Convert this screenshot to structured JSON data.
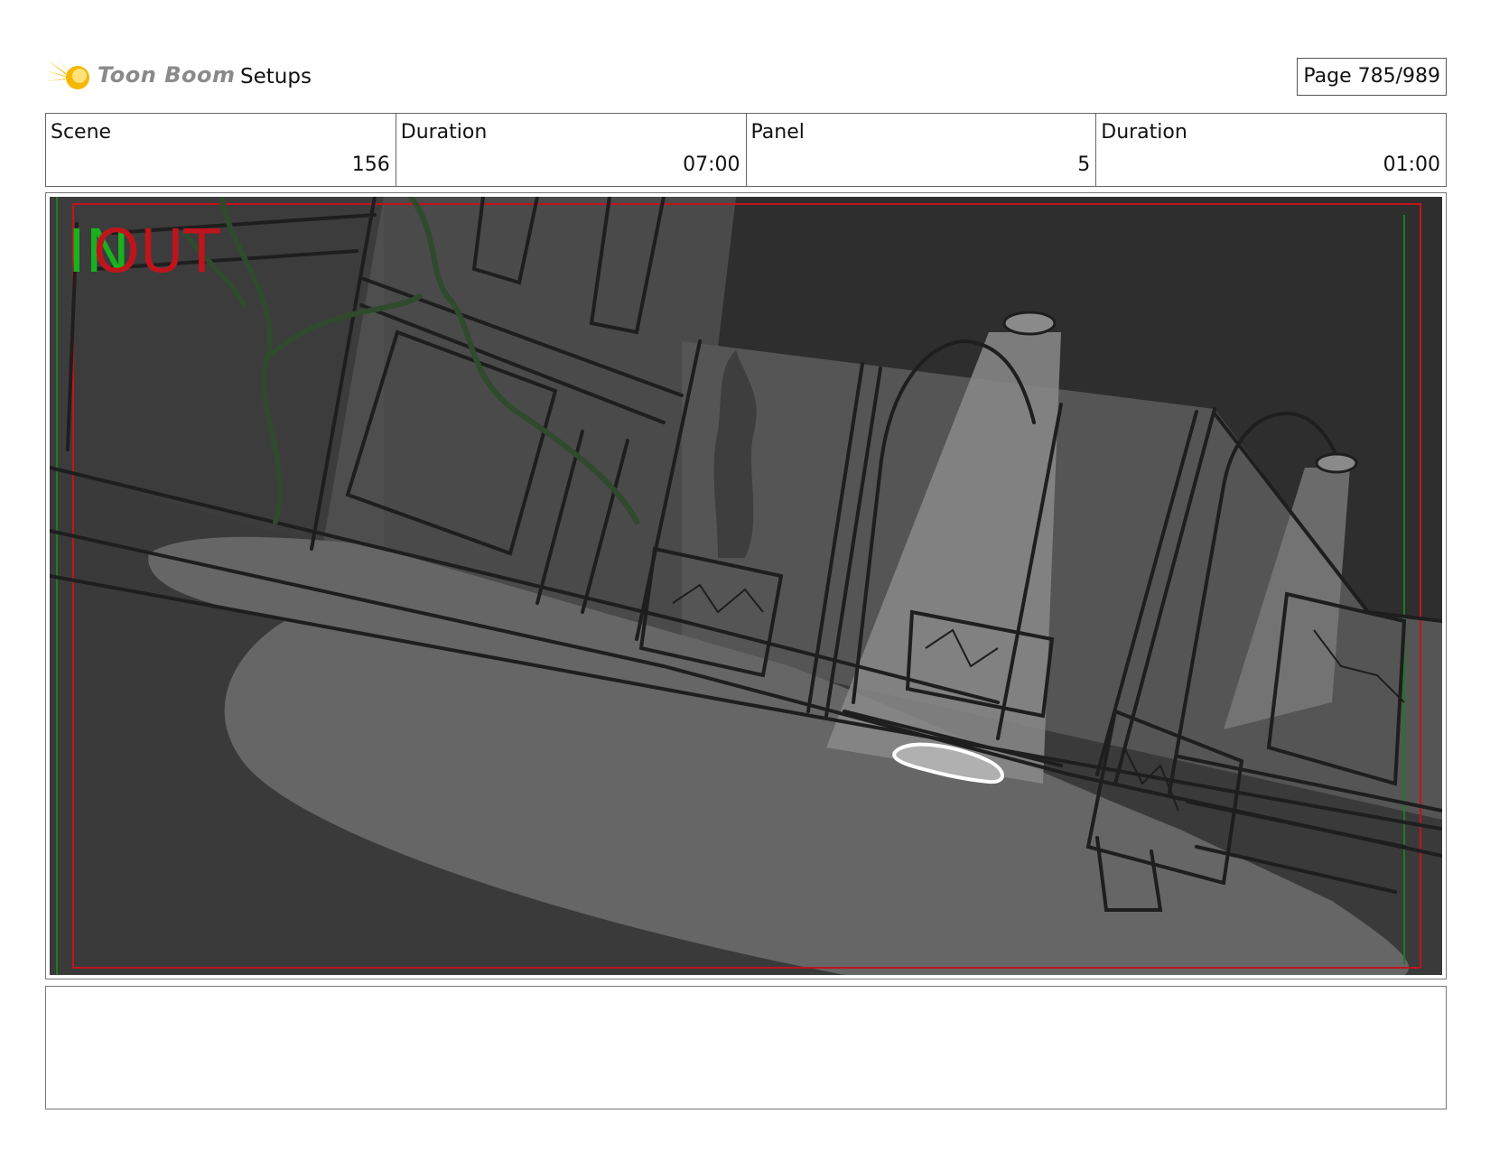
{
  "header": {
    "logo_text": "Toon Boom",
    "section_title": "Setups",
    "page_label": "Page 785/989"
  },
  "info": {
    "scene_label": "Scene",
    "scene_value": "156",
    "scene_duration_label": "Duration",
    "scene_duration_value": "07:00",
    "panel_label": "Panel",
    "panel_value": "5",
    "panel_duration_label": "Duration",
    "panel_duration_value": "01:00"
  },
  "panel": {
    "in_marker": "IN",
    "out_marker": "OUT"
  },
  "colors": {
    "logo_yellow": "#f2c418",
    "safe_frame_red": "#c0141c",
    "in_marker_green": "#19b21e",
    "sketch_dark": "#3a3a3a",
    "sketch_mid": "#5e5e5e",
    "light_cone": "#8e8e8e"
  },
  "notes": {
    "text": ""
  }
}
